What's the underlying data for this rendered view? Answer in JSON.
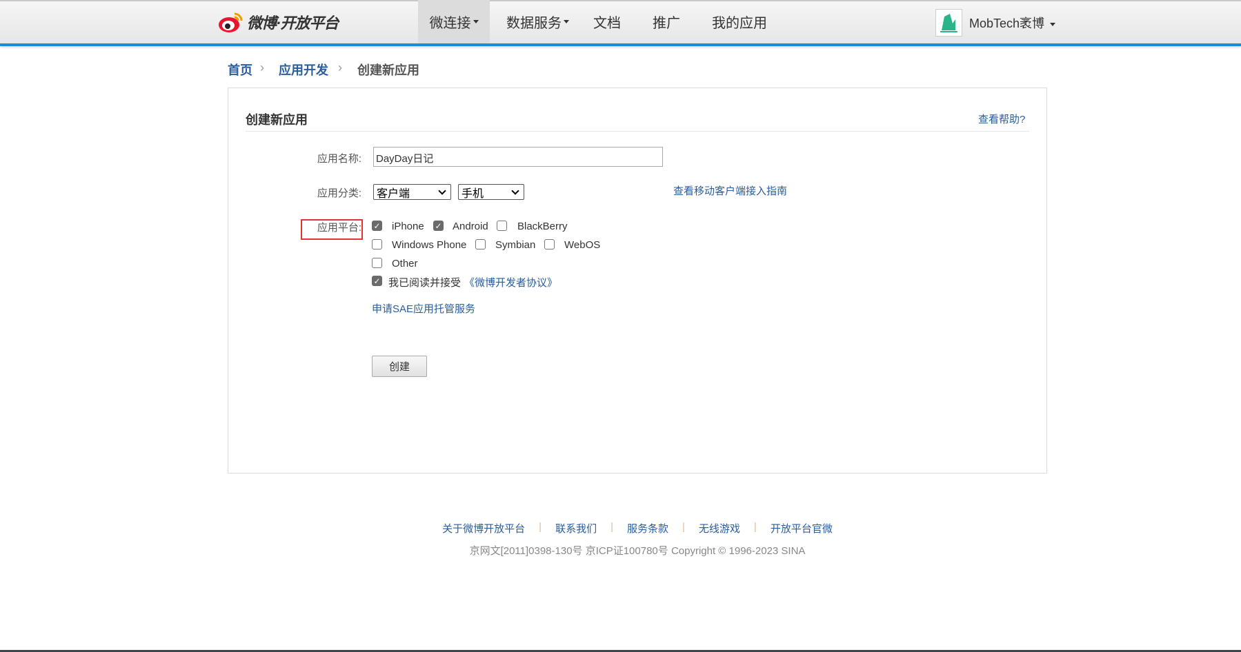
{
  "header": {
    "logo_text": "微博·开放平台",
    "nav": [
      {
        "label": "微连接",
        "dropdown": true,
        "active": true
      },
      {
        "label": "数据服务",
        "dropdown": true
      },
      {
        "label": "文档"
      },
      {
        "label": "推广"
      },
      {
        "label": "我的应用"
      }
    ],
    "username": "MobTech袤博",
    "accent_color": "#1f8ad2"
  },
  "breadcrumb": [
    "首页",
    "应用开发",
    "创建新应用"
  ],
  "form": {
    "title": "创建新应用",
    "help_link": "查看帮助?",
    "name_label": "应用名称:",
    "name_value": "DayDay日记",
    "category_label": "应用分类:",
    "category_value": "客户端",
    "subcategory_value": "手机",
    "guide_link": "查看移动客户端接入指南",
    "platform_label": "应用平台:",
    "platforms": [
      {
        "label": "iPhone",
        "checked": true
      },
      {
        "label": "Android",
        "checked": true
      },
      {
        "label": "BlackBerry",
        "checked": false
      },
      {
        "label": "Windows Phone",
        "checked": false
      },
      {
        "label": "Symbian",
        "checked": false
      },
      {
        "label": "WebOS",
        "checked": false
      },
      {
        "label": "Other",
        "checked": false
      }
    ],
    "agree_text": "我已阅读并接受",
    "agree_link": "《微博开发者协议》",
    "agree_checked": true,
    "sae_link": "申请SAE应用托管服务",
    "create_button": "创建"
  },
  "footer": {
    "links": [
      "关于微博开放平台",
      "联系我们",
      "服务条款",
      "无线游戏",
      "开放平台官微"
    ],
    "copyright": "京网文[2011]0398-130号 京ICP证100780号 Copyright © 1996-2023 SINA"
  }
}
